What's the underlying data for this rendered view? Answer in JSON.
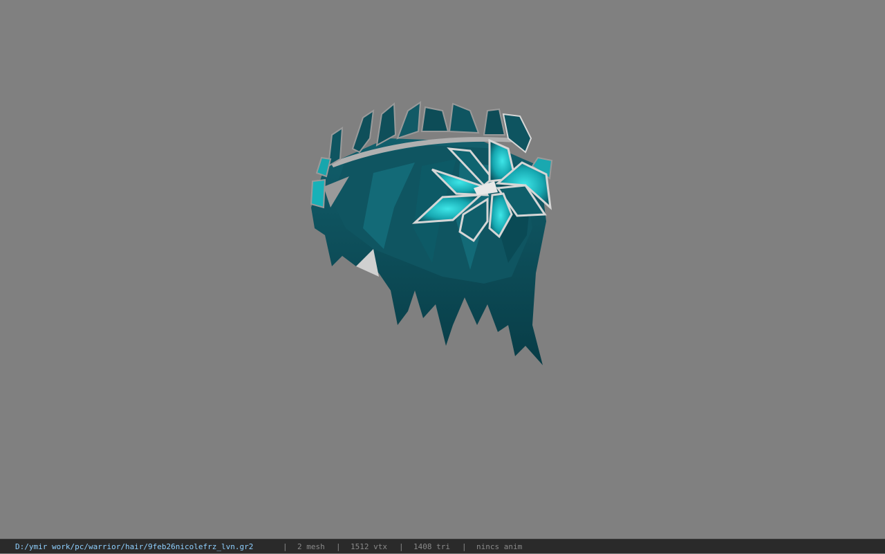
{
  "viewport": {
    "background_color": "#808080",
    "model_icon": "3d-hair-model-with-leaf-wreath",
    "model_colors": {
      "hair_dark": "#0c4550",
      "hair_mid": "#0f5a66",
      "leaf_light": "#2bd3d8",
      "leaf_outline": "#d8d8d8"
    }
  },
  "statusbar": {
    "file_path": "D:/ymir work/pc/warrior/hair/9feb26nicolefrz_lvn.gr2",
    "separator": "|",
    "mesh_count": "2 mesh",
    "vertex_count": "1512 vtx",
    "triangle_count": "1408 tri",
    "anim": "nincs anim"
  }
}
